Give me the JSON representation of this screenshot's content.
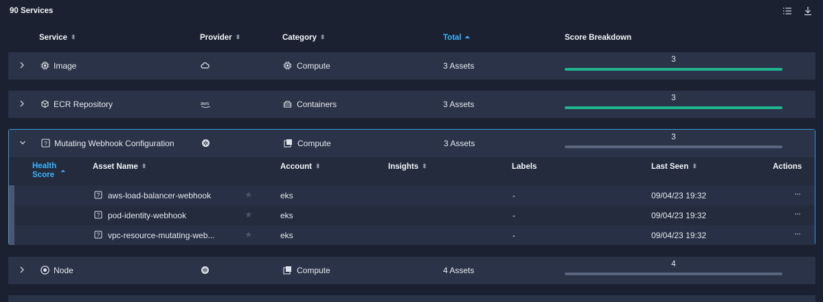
{
  "title": "90 Services",
  "toolbar": {
    "list_icon": "list-icon",
    "download_icon": "download-icon"
  },
  "columns": {
    "service": "Service",
    "provider": "Provider",
    "category": "Category",
    "total": "Total",
    "score_breakdown": "Score Breakdown"
  },
  "colors": {
    "accent": "#3bb6ff",
    "score_green": "#20b58f",
    "score_gray": "#5a6680",
    "row_bg": "#2a3347"
  },
  "rows": [
    {
      "service": "Image",
      "service_icon": "chip-icon",
      "provider_icon": "cloud-icon",
      "category": "Compute",
      "category_icon": "chip-icon",
      "total": "3 Assets",
      "score": "3",
      "score_color": "green"
    },
    {
      "service": "ECR Repository",
      "service_icon": "cube-icon",
      "provider_icon": "aws-icon",
      "category": "Containers",
      "category_icon": "container-icon",
      "total": "3 Assets",
      "score": "3",
      "score_color": "green"
    },
    {
      "service": "Mutating Webhook Configuration",
      "service_icon": "unknown-icon",
      "provider_icon": "kubernetes-icon",
      "category": "Compute",
      "category_icon": "compute-icon",
      "total": "3 Assets",
      "score": "3",
      "score_color": "gray"
    },
    {
      "service": "Node",
      "service_icon": "kubernetes-node-icon",
      "provider_icon": "kubernetes-icon",
      "category": "Compute",
      "category_icon": "compute-icon",
      "total": "4 Assets",
      "score": "4",
      "score_color": "gray"
    }
  ],
  "sub_columns": {
    "health_score": "Health Score",
    "asset_name": "Asset Name",
    "account": "Account",
    "insights": "Insights",
    "labels": "Labels",
    "last_seen": "Last Seen",
    "actions": "Actions"
  },
  "assets": [
    {
      "name": "aws-load-balancer-webhook",
      "account": "eks",
      "labels": "-",
      "last_seen": "09/04/23 19:32",
      "actions": "···"
    },
    {
      "name": "pod-identity-webhook",
      "account": "eks",
      "labels": "-",
      "last_seen": "09/04/23 19:32",
      "actions": "···"
    },
    {
      "name": "vpc-resource-mutating-web...",
      "account": "eks",
      "labels": "-",
      "last_seen": "09/04/23 19:32",
      "actions": "···"
    }
  ]
}
